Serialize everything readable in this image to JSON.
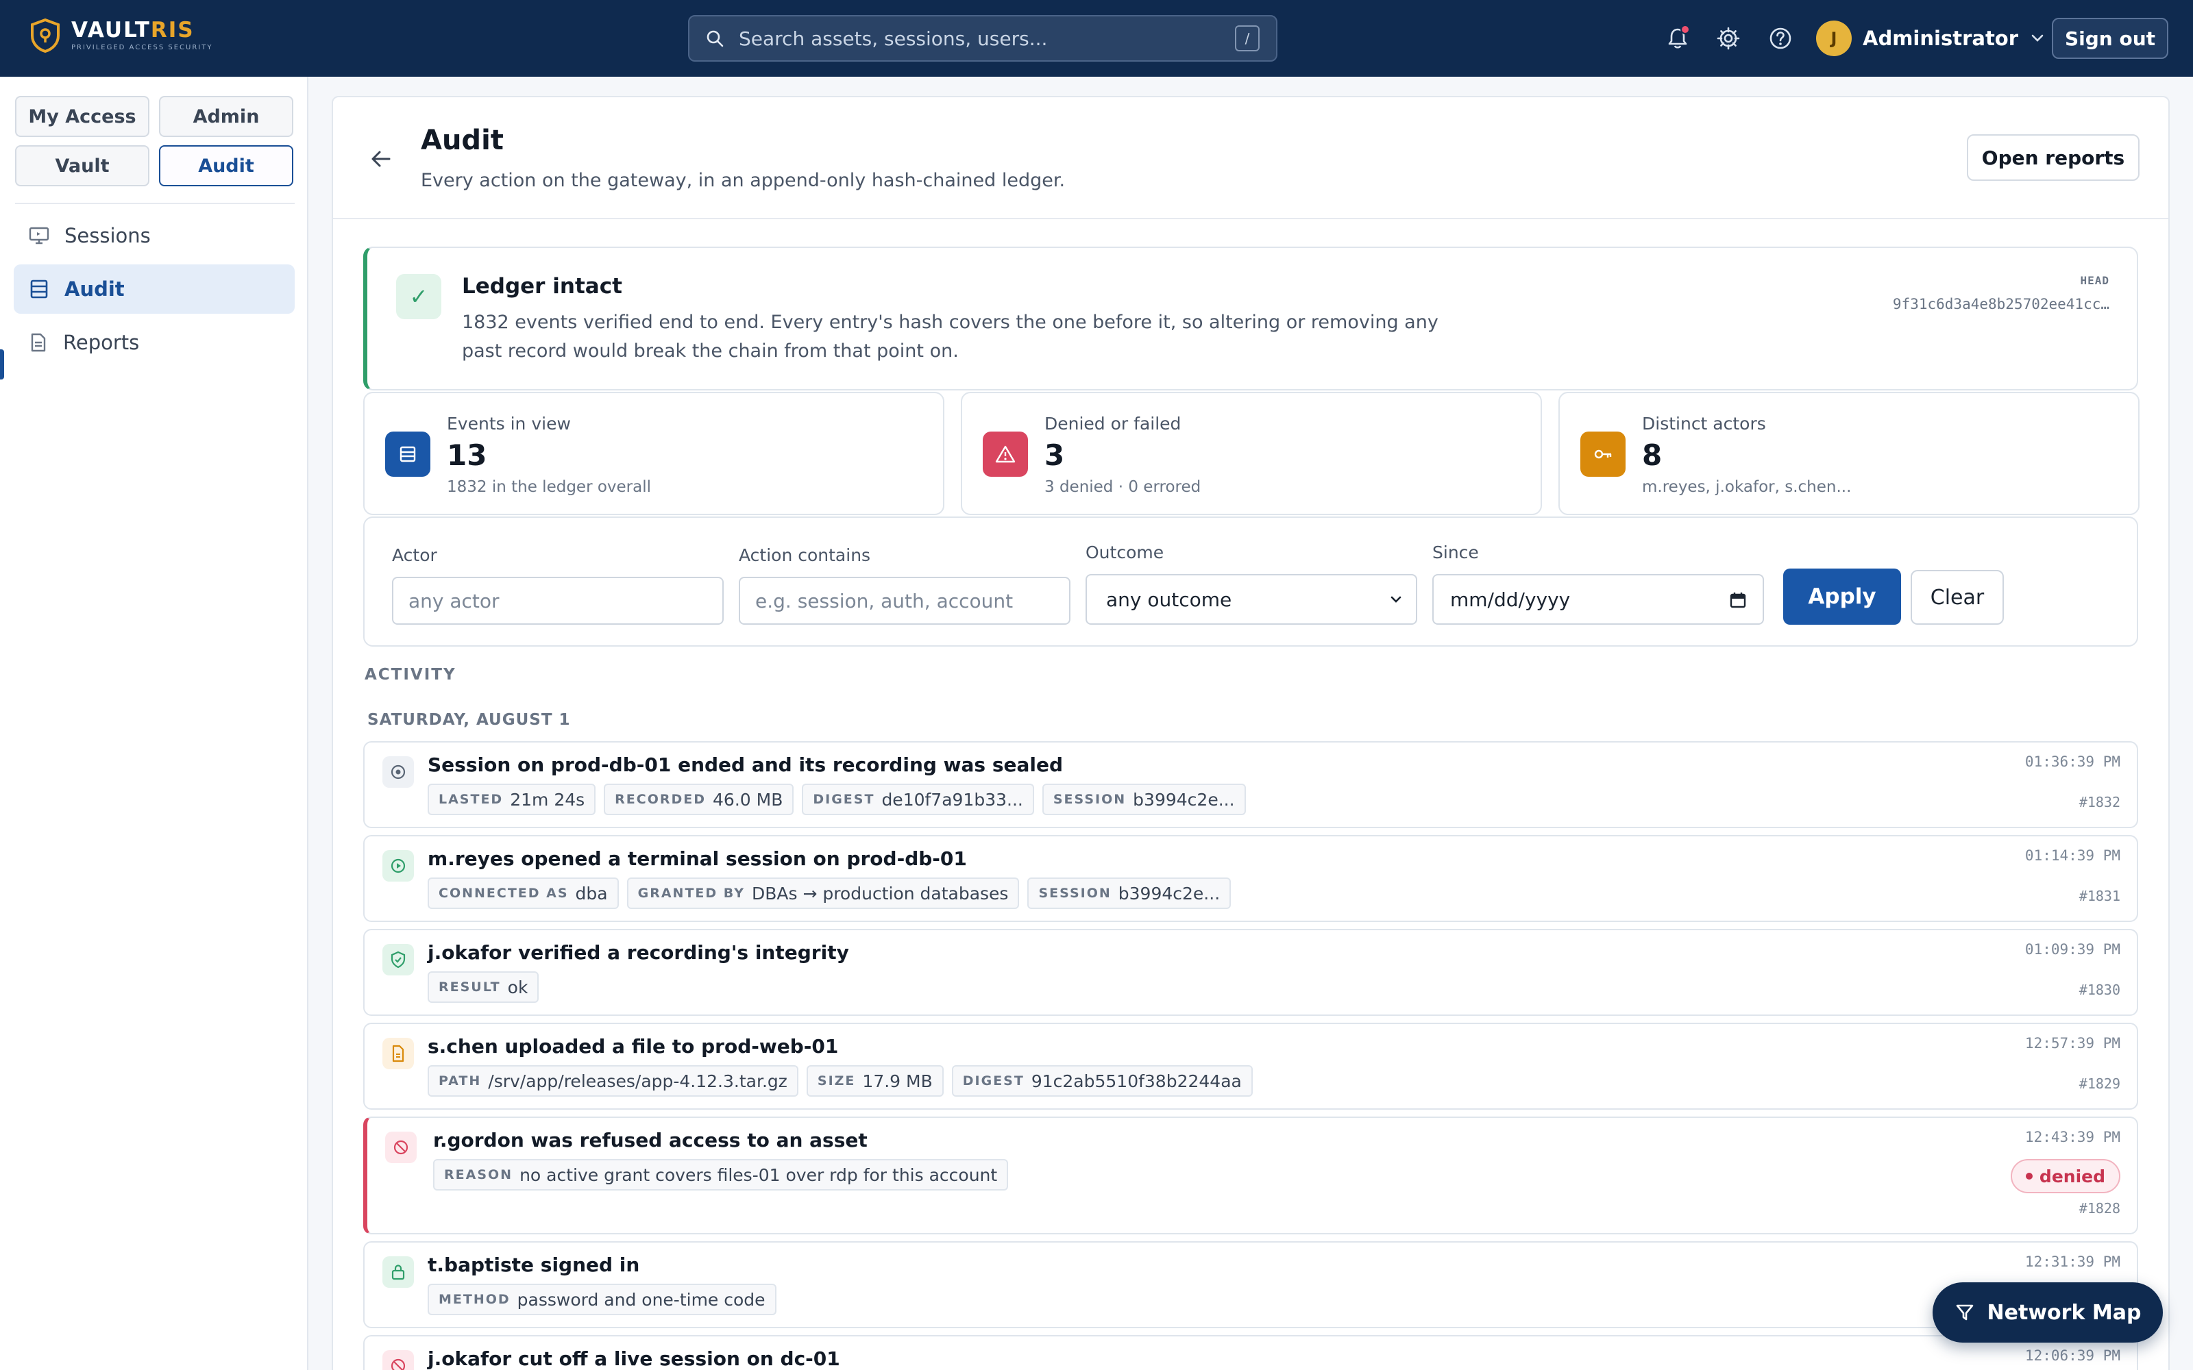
{
  "brand": {
    "name_main": "VAULT",
    "name_accent": "RIS",
    "tagline": "PRIVILEGED ACCESS SECURITY"
  },
  "search": {
    "placeholder": "Search assets, sessions, users...",
    "shortcut": "/"
  },
  "header": {
    "user_initial": "J",
    "user_name": "Administrator",
    "sign_out": "Sign out"
  },
  "sidebar": {
    "segments": [
      "My Access",
      "Admin",
      "Vault",
      "Audit"
    ],
    "active_segment": "Audit",
    "items": [
      {
        "label": "Sessions",
        "icon": "monitor-icon"
      },
      {
        "label": "Audit",
        "icon": "ledger-icon",
        "active": true
      },
      {
        "label": "Reports",
        "icon": "document-icon"
      }
    ]
  },
  "page": {
    "title": "Audit",
    "subtitle": "Every action on the gateway, in an append-only hash-chained ledger.",
    "open_reports": "Open reports"
  },
  "ledger": {
    "title": "Ledger intact",
    "text": "1832 events verified end to end. Every entry's hash covers the one before it, so altering or removing any past record would break the chain from that point on.",
    "head_label": "HEAD",
    "head_hash": "9f31c6d3a4e8b25702ee41cc…"
  },
  "stats": [
    {
      "label": "Events in view",
      "value": "13",
      "sub": "1832 in the ledger overall",
      "color": "#1a57a8"
    },
    {
      "label": "Denied or failed",
      "value": "3",
      "sub": "3 denied · 0 errored",
      "color": "#d9455f"
    },
    {
      "label": "Distinct actors",
      "value": "8",
      "sub": "m.reyes, j.okafor, s.chen...",
      "color": "#d98a0b"
    }
  ],
  "filters": {
    "actor_label": "Actor",
    "actor_placeholder": "any actor",
    "action_label": "Action contains",
    "action_placeholder": "e.g. session, auth, account",
    "outcome_label": "Outcome",
    "outcome_value": "any outcome",
    "since_label": "Since",
    "since_value": "mm/dd/yyyy",
    "apply": "Apply",
    "clear": "Clear"
  },
  "activity": {
    "section_label": "ACTIVITY",
    "day_label": "SATURDAY, AUGUST 1",
    "events": [
      {
        "title": "Session on prod-db-01 ended and its recording was sealed",
        "icon": "record-icon",
        "time": "01:36:39 PM",
        "seq": "#1832",
        "chips": [
          {
            "k": "LASTED",
            "v": "21m 24s"
          },
          {
            "k": "RECORDED",
            "v": "46.0 MB"
          },
          {
            "k": "DIGEST",
            "v": "de10f7a91b33..."
          },
          {
            "k": "SESSION",
            "v": "b3994c2e..."
          }
        ]
      },
      {
        "title": "m.reyes opened a terminal session on prod-db-01",
        "icon": "play-icon",
        "time": "01:14:39 PM",
        "seq": "#1831",
        "chips": [
          {
            "k": "CONNECTED AS",
            "v": "dba"
          },
          {
            "k": "GRANTED BY",
            "v": "DBAs → production databases"
          },
          {
            "k": "SESSION",
            "v": "b3994c2e..."
          }
        ]
      },
      {
        "title": "j.okafor verified a recording's integrity",
        "icon": "shield-check-icon",
        "time": "01:09:39 PM",
        "seq": "#1830",
        "chips": [
          {
            "k": "RESULT",
            "v": "ok"
          }
        ]
      },
      {
        "title": "s.chen uploaded a file to prod-web-01",
        "icon": "file-icon",
        "time": "12:57:39 PM",
        "seq": "#1829",
        "chips": [
          {
            "k": "PATH",
            "v": "/srv/app/releases/app-4.12.3.tar.gz"
          },
          {
            "k": "SIZE",
            "v": "17.9 MB"
          },
          {
            "k": "DIGEST",
            "v": "91c2ab5510f38b2244aa"
          }
        ]
      },
      {
        "title": "r.gordon was refused access to an asset",
        "icon": "blocked-icon",
        "time": "12:43:39 PM",
        "seq": "#1828",
        "badge": "denied",
        "chips": [
          {
            "k": "REASON",
            "v": "no active grant covers files-01 over rdp for this account"
          }
        ]
      },
      {
        "title": "t.baptiste signed in",
        "icon": "lock-icon",
        "time": "12:31:39 PM",
        "seq": "",
        "chips": [
          {
            "k": "METHOD",
            "v": "password and one-time code"
          }
        ]
      },
      {
        "title": "j.okafor cut off a live session on dc-01",
        "icon": "blocked-icon",
        "time": "12:06:39 PM",
        "seq": "",
        "chips": []
      }
    ]
  },
  "fab": {
    "label": "Network Map"
  },
  "colors": {
    "brand_navy": "#0f2a4f",
    "primary": "#1a57a8",
    "success": "#2f9e6a",
    "danger": "#d9455f",
    "warning": "#d98a0b"
  }
}
